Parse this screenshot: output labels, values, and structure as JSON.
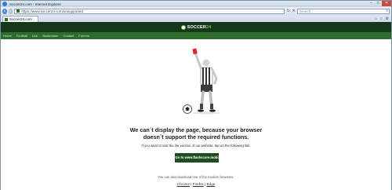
{
  "window": {
    "title": "Soccer24.com - Internet Explorer",
    "controls": [
      "–",
      "□",
      "✕"
    ]
  },
  "address_bar": {
    "url": "https://www.soccer24.com/unsupported",
    "search_placeholder": "Search..."
  },
  "tab": {
    "label": "Soccer24.com"
  },
  "site": {
    "logo_text_1": "SOCCER",
    "logo_text_2": "24",
    "nav_items": [
      "Home",
      "Football",
      "Live",
      "Bookmaker",
      "Contact",
      "Forums"
    ]
  },
  "message": {
    "headline_line1": "We can´t display the page, because your browser",
    "headline_line2": "doesn´t support the required functions.",
    "subtext": "If you want to visit the lite version of our website, tap on the following link.",
    "button_label": "Go to www.flashscore.mobi",
    "download_text": "You can also download one of the modern browsers.",
    "browsers": [
      "Chrome",
      "Firefox",
      "Edge"
    ],
    "separator": "|"
  },
  "colors": {
    "header_bg": "#16381a",
    "nav_bg": "#2d6e2c",
    "button_bg": "#1e4e1d",
    "accent": "#7dc242"
  }
}
